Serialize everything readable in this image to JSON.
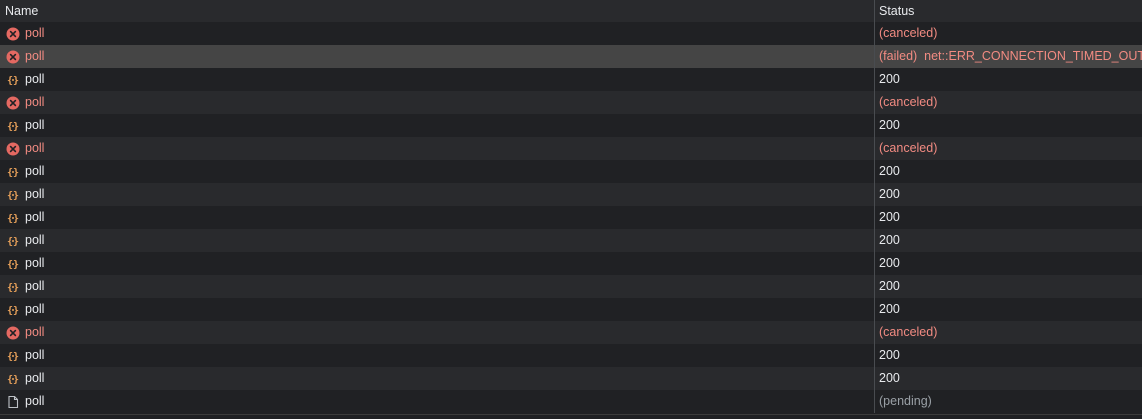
{
  "header": {
    "name_label": "Name",
    "status_label": "Status"
  },
  "colors": {
    "error_red": "#f28b82",
    "error_icon": "#e46962",
    "xhr_orange": "#e8a15a",
    "pending_gray": "#9aa0a6"
  },
  "rows": [
    {
      "name": "poll",
      "icon": "error-circle-icon",
      "status": "(canceled)",
      "state": "error"
    },
    {
      "name": "poll",
      "icon": "error-circle-icon",
      "status": "(failed)  net::ERR_CONNECTION_TIMED_OUT",
      "state": "error",
      "selected": true
    },
    {
      "name": "poll",
      "icon": "xhr-braces-icon",
      "status": "200",
      "state": "ok"
    },
    {
      "name": "poll",
      "icon": "error-circle-icon",
      "status": "(canceled)",
      "state": "error"
    },
    {
      "name": "poll",
      "icon": "xhr-braces-icon",
      "status": "200",
      "state": "ok"
    },
    {
      "name": "poll",
      "icon": "error-circle-icon",
      "status": "(canceled)",
      "state": "error"
    },
    {
      "name": "poll",
      "icon": "xhr-braces-icon",
      "status": "200",
      "state": "ok"
    },
    {
      "name": "poll",
      "icon": "xhr-braces-icon",
      "status": "200",
      "state": "ok"
    },
    {
      "name": "poll",
      "icon": "xhr-braces-icon",
      "status": "200",
      "state": "ok"
    },
    {
      "name": "poll",
      "icon": "xhr-braces-icon",
      "status": "200",
      "state": "ok"
    },
    {
      "name": "poll",
      "icon": "xhr-braces-icon",
      "status": "200",
      "state": "ok"
    },
    {
      "name": "poll",
      "icon": "xhr-braces-icon",
      "status": "200",
      "state": "ok"
    },
    {
      "name": "poll",
      "icon": "xhr-braces-icon",
      "status": "200",
      "state": "ok"
    },
    {
      "name": "poll",
      "icon": "error-circle-icon",
      "status": "(canceled)",
      "state": "error"
    },
    {
      "name": "poll",
      "icon": "xhr-braces-icon",
      "status": "200",
      "state": "ok"
    },
    {
      "name": "poll",
      "icon": "xhr-braces-icon",
      "status": "200",
      "state": "ok"
    },
    {
      "name": "poll",
      "icon": "document-icon",
      "status": "(pending)",
      "state": "pending"
    }
  ]
}
